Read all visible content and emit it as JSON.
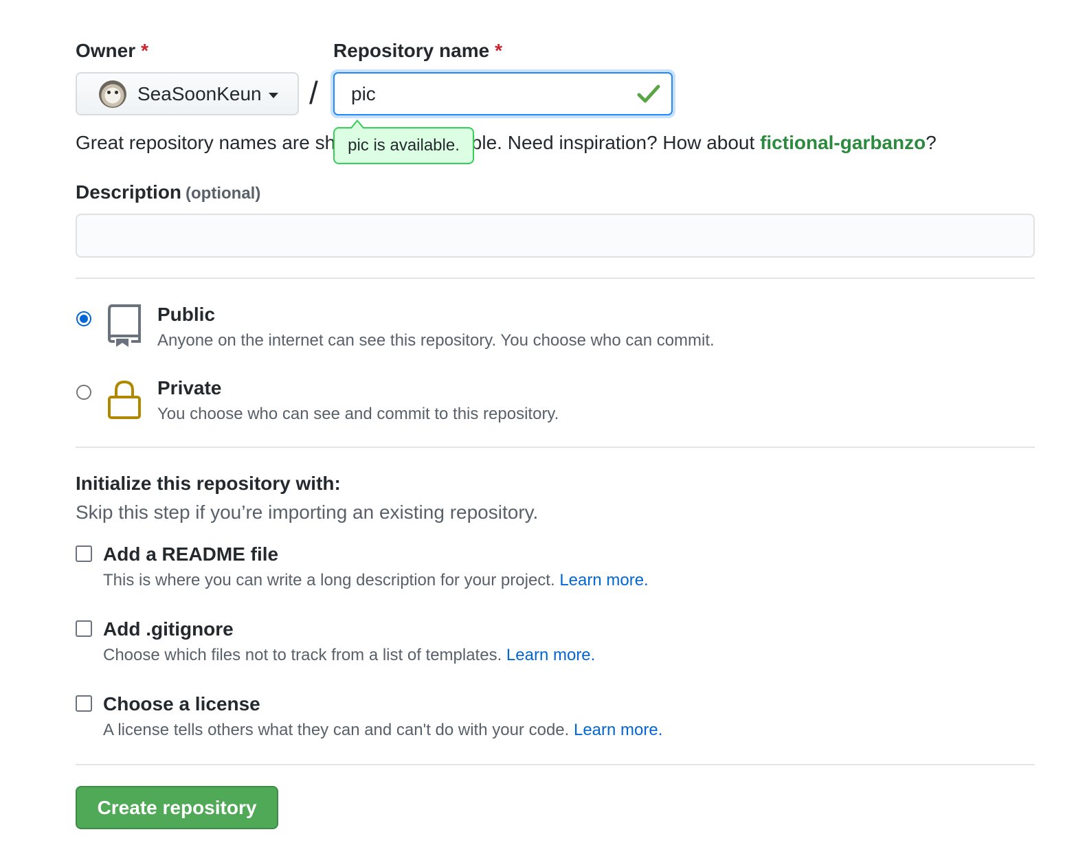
{
  "owner": {
    "label": "Owner",
    "required_mark": "*",
    "selected": "SeaSoonKeun"
  },
  "separator": "/",
  "repo_name": {
    "label": "Repository name",
    "required_mark": "*",
    "value": "pic",
    "tooltip": "pic is available.",
    "status_icon": "check-icon",
    "status_color": "#28a745"
  },
  "hint": {
    "prefix": "Great repository names are short and memorable. Need inspiration? How about ",
    "suggestion": "fictional-garbanzo",
    "suffix": "?"
  },
  "description": {
    "label": "Description",
    "optional": "(optional)",
    "value": ""
  },
  "visibility": {
    "public": {
      "title": "Public",
      "desc": "Anyone on the internet can see this repository. You choose who can commit.",
      "icon": "repo-icon",
      "selected": true
    },
    "private": {
      "title": "Private",
      "desc": "You choose who can see and commit to this repository.",
      "icon": "lock-icon",
      "selected": false
    }
  },
  "init": {
    "title": "Initialize this repository with:",
    "subtitle": "Skip this step if you’re importing an existing repository.",
    "readme": {
      "title": "Add a README file",
      "desc": "This is where you can write a long description for your project. ",
      "link": "Learn more.",
      "checked": false
    },
    "gitignore": {
      "title": "Add .gitignore",
      "desc": "Choose which files not to track from a list of templates. ",
      "link": "Learn more.",
      "checked": false
    },
    "license": {
      "title": "Choose a license",
      "desc": "A license tells others what they can and can't do with your code. ",
      "link": "Learn more.",
      "checked": false
    }
  },
  "submit": {
    "label": "Create repository",
    "color": "#4fa957"
  }
}
